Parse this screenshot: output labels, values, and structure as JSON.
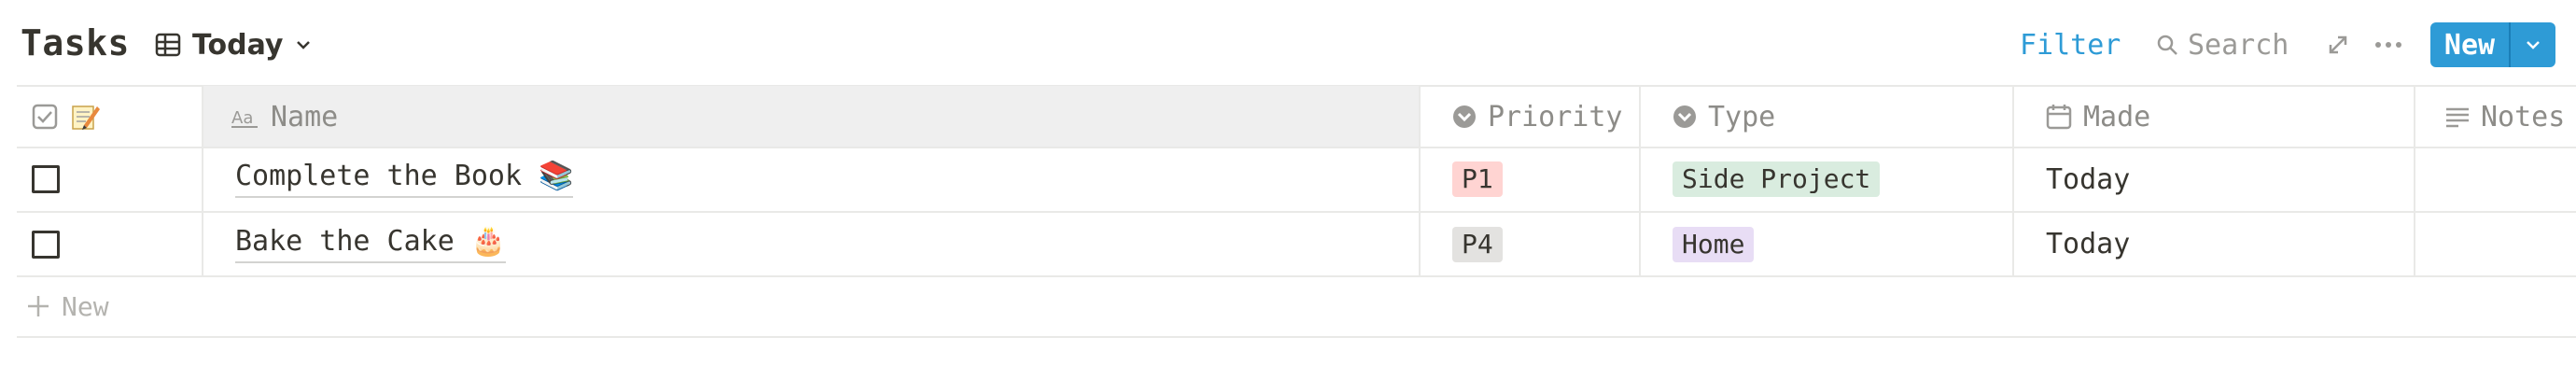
{
  "header": {
    "title": "Tasks",
    "view_label": "Today",
    "filter_label": "Filter",
    "search_label": "Search",
    "new_label": "New"
  },
  "table": {
    "columns": [
      {
        "label": "",
        "icon": "checkbox-icon"
      },
      {
        "label": "Name",
        "icon": "text-property-icon"
      },
      {
        "label": "Priority",
        "icon": "select-property-icon"
      },
      {
        "label": "Type",
        "icon": "select-property-icon"
      },
      {
        "label": "Made",
        "icon": "calendar-icon"
      },
      {
        "label": "Notes",
        "icon": "lines-icon"
      }
    ],
    "rows": [
      {
        "checked": false,
        "name": "Complete the Book 📚",
        "priority": "P1",
        "type": "Side Project",
        "made": "Today",
        "notes": ""
      },
      {
        "checked": false,
        "name": "Bake the Cake 🎂",
        "priority": "P4",
        "type": "Home",
        "made": "Today",
        "notes": ""
      }
    ],
    "add_row_label": "New"
  },
  "colors": {
    "accent": "#2e9bd6",
    "p1_bg": "#ffd4d2",
    "p4_bg": "#e3e2e0",
    "side_project_bg": "#d9ecdf",
    "home_bg": "#e8ddf5",
    "header_cell_bg": "#efefef"
  }
}
